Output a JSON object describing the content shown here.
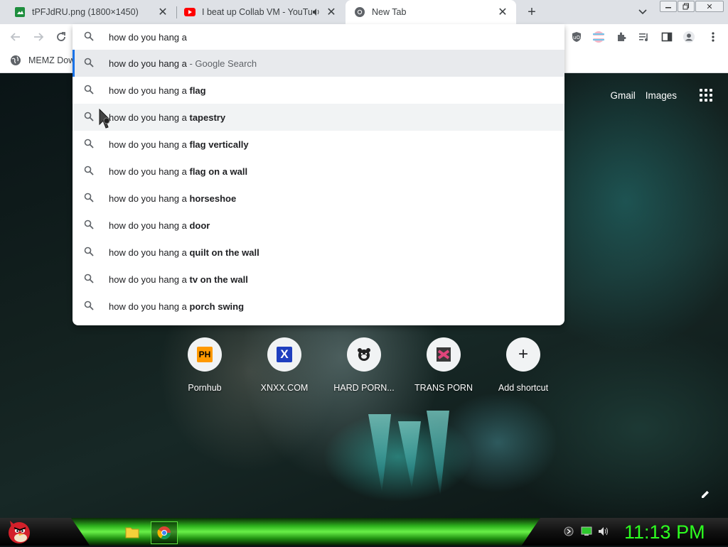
{
  "tabs": [
    {
      "title": "tPFJdRU.png (1800×1450)",
      "icon": "image-favicon-icon"
    },
    {
      "title": "I beat up Collab VM - YouTube",
      "icon": "youtube-favicon-icon",
      "audio": true
    },
    {
      "title": "New Tab",
      "icon": "chrome-favicon-icon",
      "active": true
    }
  ],
  "bookmarks": [
    {
      "label": "MEMZ Dow",
      "icon": "globe-icon"
    }
  ],
  "omnibox": {
    "value": "how do you hang a",
    "suggestions": [
      {
        "base": "how do you hang a",
        "bold": "",
        "suffix": " - Google Search",
        "state": "selected"
      },
      {
        "base": "how do you hang a ",
        "bold": "flag",
        "suffix": ""
      },
      {
        "base": "how do you hang a ",
        "bold": "tapestry",
        "suffix": "",
        "state": "hover"
      },
      {
        "base": "how do you hang a ",
        "bold": "flag vertically",
        "suffix": ""
      },
      {
        "base": "how do you hang a ",
        "bold": "flag on a wall",
        "suffix": ""
      },
      {
        "base": "how do you hang a ",
        "bold": "horseshoe",
        "suffix": ""
      },
      {
        "base": "how do you hang a ",
        "bold": "door",
        "suffix": ""
      },
      {
        "base": "how do you hang a ",
        "bold": "quilt on the wall",
        "suffix": ""
      },
      {
        "base": "how do you hang a ",
        "bold": "tv on the wall",
        "suffix": ""
      },
      {
        "base": "how do you hang a ",
        "bold": "porch swing",
        "suffix": ""
      }
    ]
  },
  "ntp": {
    "links": {
      "gmail": "Gmail",
      "images": "Images"
    },
    "shortcuts": [
      {
        "label": "Pornhub",
        "icon_text": "PH"
      },
      {
        "label": "XNXX.COM",
        "icon_text": "X"
      },
      {
        "label": "HARD PORN...",
        "icon_text": ""
      },
      {
        "label": "TRANS PORN",
        "icon_text": ""
      },
      {
        "label": "Add shortcut",
        "icon_text": "+"
      }
    ]
  },
  "taskbar": {
    "clock": "11:13 PM",
    "accent": "#2dff20"
  }
}
